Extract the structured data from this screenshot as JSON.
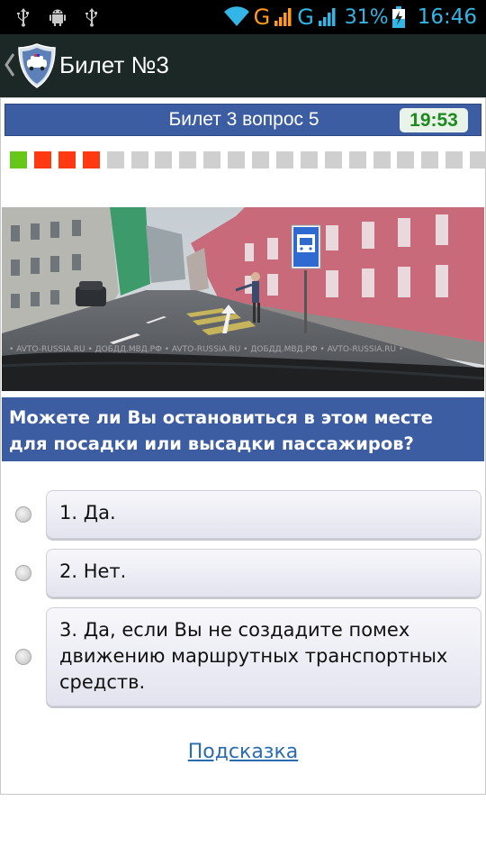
{
  "status_bar": {
    "network_letters": [
      "G",
      "G"
    ],
    "battery_percent": "31%",
    "time": "16:46",
    "left_icons": [
      "usb-icon",
      "android-debug-icon",
      "usb-icon"
    ],
    "right_icons": [
      "wifi-icon",
      "signal-icon",
      "signal-icon",
      "battery-charging-icon"
    ]
  },
  "app_bar": {
    "title": "Билет №3",
    "icons": [
      "back-chevron-icon",
      "police-shield-logo-icon"
    ]
  },
  "ticket_header": {
    "label": "Билет 3 вопрос 5",
    "timer": "19:53"
  },
  "progress": {
    "statuses": [
      "correct",
      "wrong",
      "wrong",
      "wrong",
      "pending",
      "pending",
      "pending",
      "pending",
      "pending",
      "pending",
      "pending",
      "pending",
      "pending",
      "pending",
      "pending",
      "pending",
      "pending",
      "pending",
      "pending",
      "pending"
    ],
    "colors": {
      "correct": "#66c61a",
      "wrong": "#ff3a12",
      "pending": "#cfcfcf"
    }
  },
  "photo": {
    "watermark": "• AVTO-RUSSIA.RU • ДОБДД.МВД.РФ • AVTO-RUSSIA.RU • ДОБДД.МВД.РФ • AVTO-RUSSIA.RU •"
  },
  "question": {
    "text": "Можете ли Вы остановиться в этом месте для посадки или высадки пассажиров?"
  },
  "answers": [
    {
      "text": "1. Да."
    },
    {
      "text": "2. Нет."
    },
    {
      "text": "3. Да, если Вы не создадите помех движению маршрутных транспортных средств."
    }
  ],
  "hint_label": "Подсказка",
  "colors": {
    "header_blue": "#3c5da2",
    "app_bar": "#1b2826",
    "status_accent": "#33b5e5",
    "timer_green": "#1d8a1d",
    "link_blue": "#2b6cb0"
  }
}
